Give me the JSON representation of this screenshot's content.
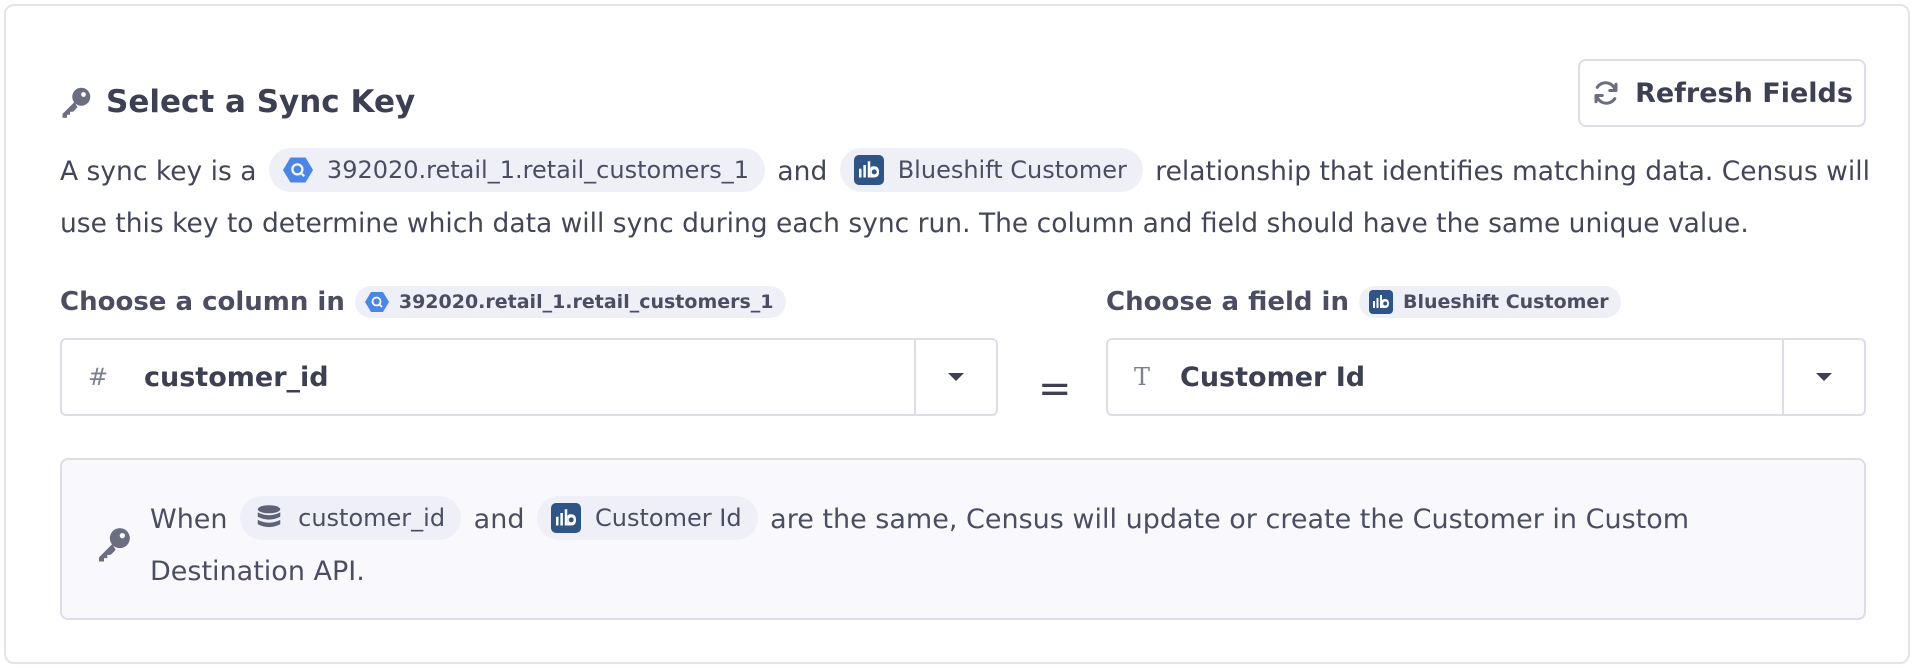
{
  "header": {
    "title": "Select a Sync Key",
    "icon": "key-icon"
  },
  "toolbar": {
    "refresh_label": "Refresh Fields",
    "refresh_icon": "refresh-icon"
  },
  "description": {
    "prefix": "A sync key is a",
    "source_chip": "392020.retail_1.retail_customers_1",
    "and": "and",
    "dest_chip": "Blueshift Customer",
    "suffix": "relationship that identifies matching data. Census will use this key to determine which data will sync during each sync run. The column and field should have the same unique value."
  },
  "source": {
    "label": "Choose a column in",
    "chip": "392020.retail_1.retail_customers_1",
    "type_icon": "#",
    "value": "customer_id"
  },
  "equals": "=",
  "destination": {
    "label": "Choose a field in",
    "chip": "Blueshift Customer",
    "type_icon": "T",
    "value": "Customer Id"
  },
  "info": {
    "when": "When",
    "col_chip": "customer_id",
    "and": "and",
    "field_chip": "Customer Id",
    "rest": "are the same, Census will update or create the Customer in Custom Destination API."
  },
  "colors": {
    "bigquery_blue": "#4a86e8",
    "blueshift_navy": "#2f5486",
    "border": "#dcdde8",
    "chip_bg": "#efeff7"
  }
}
